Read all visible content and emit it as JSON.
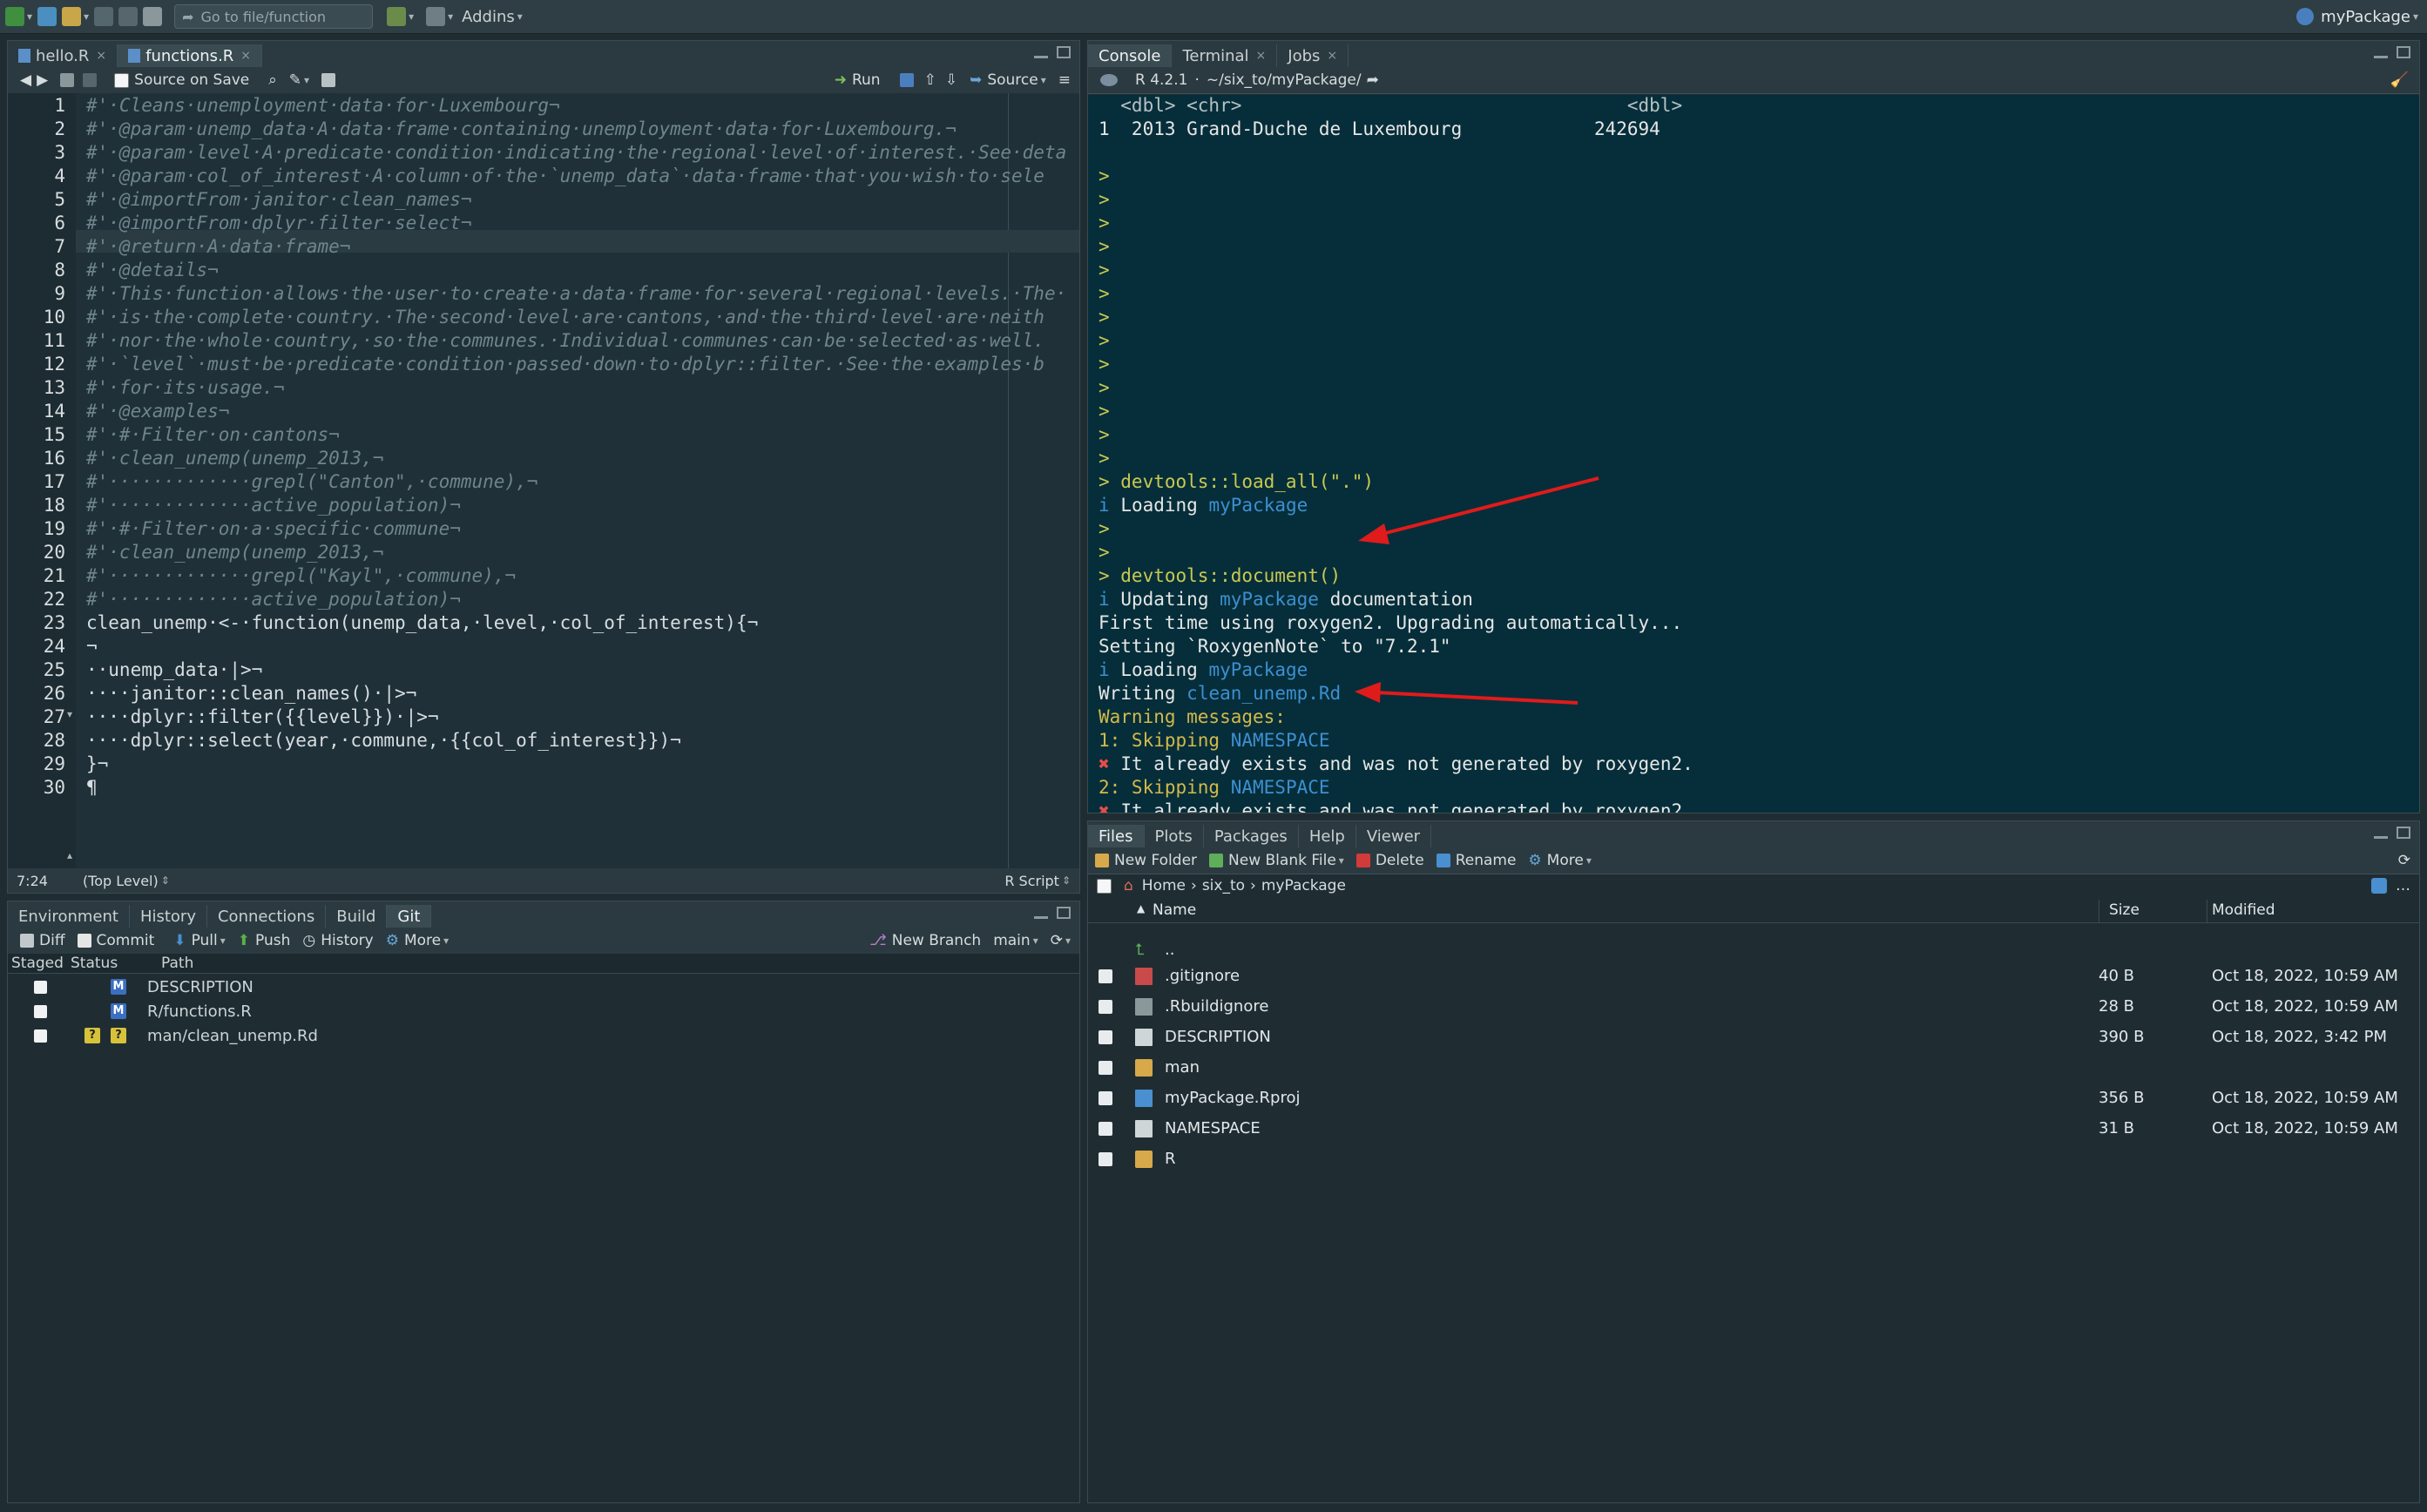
{
  "toolbar": {
    "goto_placeholder": "Go to file/function",
    "addins": "Addins",
    "project": "myPackage"
  },
  "editor": {
    "tabs": [
      {
        "label": "hello.R"
      },
      {
        "label": "functions.R"
      }
    ],
    "source_on_save": "Source on Save",
    "run": "Run",
    "source": "Source",
    "status_pos": "7:24",
    "status_scope": "(Top Level)",
    "status_type": "R Script",
    "lines": [
      "#'·Cleans·unemployment·data·for·Luxembourg¬",
      "#'·@param·unemp_data·A·data·frame·containing·unemployment·data·for·Luxembourg.¬",
      "#'·@param·level·A·predicate·condition·indicating·the·regional·level·of·interest.·See·deta",
      "#'·@param·col_of_interest·A·column·of·the·`unemp_data`·data·frame·that·you·wish·to·sele",
      "#'·@importFrom·janitor·clean_names¬",
      "#'·@importFrom·dplyr·filter·select¬",
      "#'·@return·A·data·frame¬",
      "#'·@details¬",
      "#'·This·function·allows·the·user·to·create·a·data·frame·for·several·regional·levels.·The·",
      "#'·is·the·complete·country.·The·second·level·are·cantons,·and·the·third·level·are·neith",
      "#'·nor·the·whole·country,·so·the·communes.·Individual·communes·can·be·selected·as·well.",
      "#'·`level`·must·be·predicate·condition·passed·down·to·dplyr::filter.·See·the·examples·b",
      "#'·for·its·usage.¬",
      "#'·@examples¬",
      "#'·#·Filter·on·cantons¬",
      "#'·clean_unemp(unemp_2013,¬",
      "#'·············grepl(\"Canton\",·commune),¬",
      "#'·············active_population)¬",
      "#'·#·Filter·on·a·specific·commune¬",
      "#'·clean_unemp(unemp_2013,¬",
      "#'·············grepl(\"Kayl\",·commune),¬",
      "#'·············active_population)¬",
      "clean_unemp·<-·function(unemp_data,·level,·col_of_interest){¬",
      "¬",
      "··unemp_data·|>¬",
      "····janitor::clean_names()·|>¬",
      "····dplyr::filter({{level}})·|>¬",
      "····dplyr::select(year,·commune,·{{col_of_interest}})¬",
      "}¬",
      "¶"
    ]
  },
  "console": {
    "tabs": [
      {
        "label": "Console"
      },
      {
        "label": "Terminal"
      },
      {
        "label": "Jobs"
      }
    ],
    "version": "R 4.2.1",
    "path": "~/six_to/myPackage/",
    "header_row": "  <dbl> <chr>                                   <dbl>",
    "row1": "1  2013 Grand-Duche de Luxembourg            242694",
    "prompt": ">",
    "load_cmd": "> devtools::load_all(\".\")",
    "loading_a": "Loading",
    "pkg": "myPackage",
    "doc_cmd": "> devtools::document()",
    "updating": "Updating",
    "documentation": "documentation",
    "first_time": "First time using roxygen2. Upgrading automatically...",
    "setting": "Setting `RoxygenNote` to \"7.2.1\"",
    "writing": "Writing",
    "rd_file": "clean_unemp.Rd",
    "warning": "Warning messages:",
    "skip1": "1: Skipping",
    "skip2": "2: Skipping",
    "namespace": "NAMESPACE",
    "exists": "It already exists and was not generated by roxygen2.",
    "info_glyph": "i",
    "x_glyph": "✖"
  },
  "files": {
    "tabs": [
      {
        "label": "Files"
      },
      {
        "label": "Plots"
      },
      {
        "label": "Packages"
      },
      {
        "label": "Help"
      },
      {
        "label": "Viewer"
      }
    ],
    "new_folder": "New Folder",
    "new_blank": "New Blank File",
    "delete": "Delete",
    "rename": "Rename",
    "more": "More",
    "crumbs": [
      "Home",
      "six_to",
      "myPackage"
    ],
    "col_name": "Name",
    "col_size": "Size",
    "col_modified": "Modified",
    "up": "..",
    "rows": [
      {
        "name": ".gitignore",
        "size": "40 B",
        "modified": "Oct 18, 2022, 10:59 AM"
      },
      {
        "name": ".Rbuildignore",
        "size": "28 B",
        "modified": "Oct 18, 2022, 10:59 AM"
      },
      {
        "name": "DESCRIPTION",
        "size": "390 B",
        "modified": "Oct 18, 2022, 3:42 PM"
      },
      {
        "name": "man",
        "size": "",
        "modified": ""
      },
      {
        "name": "myPackage.Rproj",
        "size": "356 B",
        "modified": "Oct 18, 2022, 10:59 AM"
      },
      {
        "name": "NAMESPACE",
        "size": "31 B",
        "modified": "Oct 18, 2022, 10:59 AM"
      },
      {
        "name": "R",
        "size": "",
        "modified": ""
      }
    ]
  },
  "git": {
    "tabs": [
      {
        "label": "Environment"
      },
      {
        "label": "History"
      },
      {
        "label": "Connections"
      },
      {
        "label": "Build"
      },
      {
        "label": "Git"
      }
    ],
    "diff": "Diff",
    "commit": "Commit",
    "pull": "Pull",
    "push": "Push",
    "history": "History",
    "more": "More",
    "new_branch": "New Branch",
    "branch": "main",
    "col_staged": "Staged",
    "col_status": "Status",
    "col_path": "Path",
    "rows": [
      {
        "status": "M",
        "path": "DESCRIPTION"
      },
      {
        "status": "M",
        "path": "R/functions.R"
      },
      {
        "status": "?",
        "path": "man/clean_unemp.Rd"
      }
    ]
  },
  "colors": {
    "accent_red": "#e01b1b",
    "console_bg": "#052e3a",
    "editor_bg": "#1f3038"
  }
}
